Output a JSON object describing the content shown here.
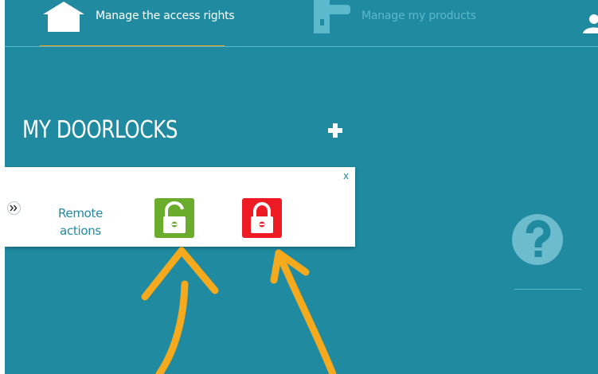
{
  "nav": {
    "items": [
      {
        "label": "Manage the access rights",
        "icon": "home-icon",
        "active": true
      },
      {
        "label": "Manage my products",
        "icon": "door-handle-icon",
        "active": false
      }
    ],
    "user_icon": "user-icon"
  },
  "page": {
    "title": "MY DOORLOCKS",
    "add_icon": "plus-icon"
  },
  "card": {
    "close_label": "x",
    "expand_icon": "double-chevron-right-icon",
    "remote_label_line1": "Remote",
    "remote_label_line2": "actions",
    "actions": [
      {
        "name": "unlock",
        "icon": "unlocked-padlock-icon",
        "color": "#6aad2c"
      },
      {
        "name": "lock",
        "icon": "locked-padlock-icon",
        "color": "#ee1b24"
      }
    ]
  },
  "help": {
    "label": "?"
  },
  "colors": {
    "background": "#1f8aa0",
    "accent": "#e8a21c",
    "annotation": "#f5a91c"
  }
}
